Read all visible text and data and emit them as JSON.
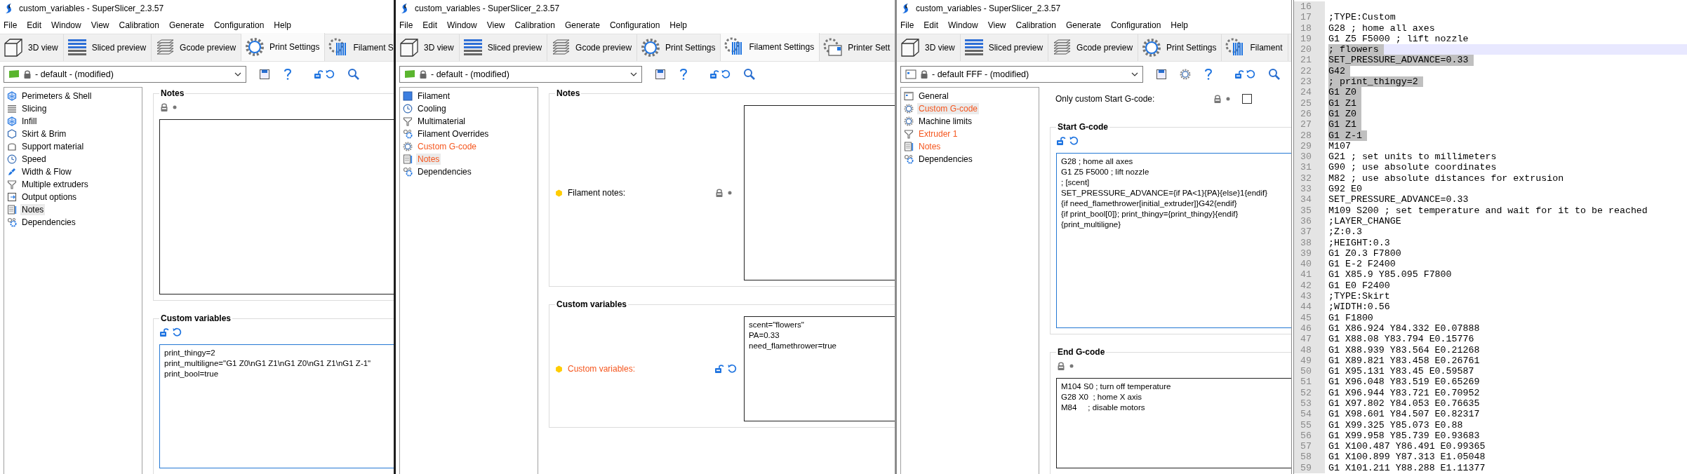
{
  "windows": [
    {
      "kind": "print",
      "title": "custom_variables - SuperSlicer_2.3.57",
      "menu": [
        "File",
        "Edit",
        "Window",
        "View",
        "Calibration",
        "Generate",
        "Configuration",
        "Help"
      ],
      "tabs": [
        {
          "label": "3D view",
          "kind": "view3d",
          "selected": false
        },
        {
          "label": "Sliced preview",
          "kind": "sliced",
          "selected": false
        },
        {
          "label": "Gcode preview",
          "kind": "gcode",
          "selected": false
        },
        {
          "label": "Print Settings",
          "kind": "print",
          "selected": true
        },
        {
          "label": "Filament S",
          "kind": "filament",
          "selected": false
        }
      ],
      "preset": "- default - (modified)",
      "sidebar": [
        {
          "label": "Perimeters & Shell",
          "kind": "perimeters",
          "selected": false,
          "modified": false
        },
        {
          "label": "Slicing",
          "kind": "slicing",
          "selected": false,
          "modified": false
        },
        {
          "label": "Infill",
          "kind": "infill",
          "selected": false,
          "modified": false
        },
        {
          "label": "Skirt & Brim",
          "kind": "skirt",
          "selected": false,
          "modified": false
        },
        {
          "label": "Support material",
          "kind": "support",
          "selected": false,
          "modified": false
        },
        {
          "label": "Speed",
          "kind": "speed",
          "selected": false,
          "modified": false
        },
        {
          "label": "Width & Flow",
          "kind": "width",
          "selected": false,
          "modified": false
        },
        {
          "label": "Multiple extruders",
          "kind": "extruders",
          "selected": false,
          "modified": false
        },
        {
          "label": "Output options",
          "kind": "output",
          "selected": false,
          "modified": false
        },
        {
          "label": "Notes",
          "kind": "notes",
          "selected": true,
          "modified": false
        },
        {
          "label": "Dependencies",
          "kind": "dependencies",
          "selected": false,
          "modified": false
        }
      ],
      "groups": [
        {
          "title": "Notes",
          "kind": "stacked",
          "locked": true,
          "focused": false
        },
        {
          "title": "Custom variables",
          "kind": "stacked",
          "locked": false,
          "focused": true,
          "lines": [
            "print_thingy=2",
            "print_multiligne=\"G1 Z0\\nG1 Z1\\nG1 Z0\\nG1 Z1\\nG1 Z-1\"",
            "print_bool=true"
          ]
        }
      ]
    },
    {
      "kind": "filament",
      "title": "custom_variables - SuperSlicer_2.3.57",
      "menu": [
        "File",
        "Edit",
        "Window",
        "View",
        "Calibration",
        "Generate",
        "Configuration",
        "Help"
      ],
      "tabs": [
        {
          "label": "3D view",
          "kind": "view3d",
          "selected": false
        },
        {
          "label": "Sliced preview",
          "kind": "sliced",
          "selected": false
        },
        {
          "label": "Gcode preview",
          "kind": "gcode",
          "selected": false
        },
        {
          "label": "Print Settings",
          "kind": "print",
          "selected": false
        },
        {
          "label": "Filament Settings",
          "kind": "filament",
          "selected": true
        },
        {
          "label": "Printer Sett",
          "kind": "printer",
          "selected": false
        }
      ],
      "preset": "- default - (modified)",
      "sidebar": [
        {
          "label": "Filament",
          "kind": "filament",
          "selected": false,
          "modified": false
        },
        {
          "label": "Cooling",
          "kind": "cooling",
          "selected": false,
          "modified": false
        },
        {
          "label": "Multimaterial",
          "kind": "multimaterial",
          "selected": false,
          "modified": false
        },
        {
          "label": "Filament Overrides",
          "kind": "overrides",
          "selected": false,
          "modified": false
        },
        {
          "label": "Custom G-code",
          "kind": "gcode",
          "selected": false,
          "modified": true
        },
        {
          "label": "Notes",
          "kind": "notes",
          "selected": true,
          "modified": true
        },
        {
          "label": "Dependencies",
          "kind": "dependencies",
          "selected": false,
          "modified": false
        }
      ],
      "groups": [
        {
          "title": "Notes",
          "kind": "side",
          "label": "Filament notes:",
          "modified": false,
          "locked": true,
          "focused": false
        },
        {
          "title": "Custom variables",
          "kind": "side",
          "label": "Custom variables:",
          "modified": true,
          "locked": false,
          "focused": false,
          "lines": [
            "scent=\"flowers\"",
            "PA=0.33",
            "need_flamethrower=true"
          ]
        }
      ]
    },
    {
      "kind": "printer",
      "title": "custom_variables - SuperSlicer_2.3.57",
      "menu": [
        "File",
        "Edit",
        "Window",
        "View",
        "Calibration",
        "Generate",
        "Configuration",
        "Help"
      ],
      "tabs": [
        {
          "label": "3D view",
          "kind": "view3d",
          "selected": false
        },
        {
          "label": "Sliced preview",
          "kind": "sliced",
          "selected": false
        },
        {
          "label": "Gcode preview",
          "kind": "gcode",
          "selected": false
        },
        {
          "label": "Print Settings",
          "kind": "print",
          "selected": false
        },
        {
          "label": "Filament",
          "kind": "filament",
          "selected": false
        }
      ],
      "preset": "- default FFF - (modified)",
      "sidebar": [
        {
          "label": "General",
          "kind": "general",
          "selected": false,
          "modified": false
        },
        {
          "label": "Custom G-code",
          "kind": "gcode",
          "selected": true,
          "modified": true
        },
        {
          "label": "Machine limits",
          "kind": "limits",
          "selected": false,
          "modified": false
        },
        {
          "label": "Extruder 1",
          "kind": "extruders",
          "selected": false,
          "modified": true
        },
        {
          "label": "Notes",
          "kind": "notes",
          "selected": false,
          "modified": true
        },
        {
          "label": "Dependencies",
          "kind": "dependencies",
          "selected": false,
          "modified": false
        }
      ],
      "option": {
        "label": "Only custom Start G-code:",
        "locked": true,
        "checked": false
      },
      "groups": [
        {
          "title": "Start G-code",
          "kind": "stacked",
          "locked": false,
          "focused": true,
          "lines": [
            "G28 ; home all axes",
            "G1 Z5 F5000 ; lift nozzle",
            "; [scent]",
            "SET_PRESSURE_ADVANCE={if PA<1}{PA}{else}1{endif}",
            "{if need_flamethrower[initial_extruder]}G42{endif}",
            "{if print_bool[0]}; print_thingy={print_thingy}{endif}",
            "{print_multiligne}"
          ]
        },
        {
          "title": "End G-code",
          "kind": "stacked",
          "locked": true,
          "focused": false,
          "lines": [
            "M104 S0 ; turn off temperature",
            "G28 X0  ; home X axis",
            "M84     ; disable motors"
          ]
        }
      ]
    }
  ],
  "editor": {
    "lines": [
      {
        "number": "16",
        "selected": false,
        "current": false
      },
      {
        "number": "17",
        "text": ";TYPE:Custom",
        "selected": false,
        "current": false
      },
      {
        "number": "18",
        "text": "G28 ; home all axes",
        "selected": false,
        "current": false
      },
      {
        "number": "19",
        "text": "G1 Z5 F5000 ; lift nozzle",
        "selected": false,
        "current": false
      },
      {
        "number": "20",
        "text": "; flowers",
        "selected": true,
        "current": true
      },
      {
        "number": "21",
        "text": "SET_PRESSURE_ADVANCE=0.33",
        "selected": true,
        "current": false
      },
      {
        "number": "22",
        "text": "G42",
        "selected": true,
        "current": false
      },
      {
        "number": "23",
        "text": "; print_thingy=2",
        "selected": true,
        "current": false
      },
      {
        "number": "24",
        "text": "G1 Z0",
        "selected": true,
        "current": false
      },
      {
        "number": "25",
        "text": "G1 Z1",
        "selected": true,
        "current": false
      },
      {
        "number": "26",
        "text": "G1 Z0",
        "selected": true,
        "current": false
      },
      {
        "number": "27",
        "text": "G1 Z1",
        "selected": true,
        "current": false
      },
      {
        "number": "28",
        "text": "G1 Z-1",
        "selected": true,
        "current": false
      },
      {
        "number": "29",
        "text": "M107",
        "selected": false,
        "current": false
      },
      {
        "number": "30",
        "text": "G21 ; set units to millimeters",
        "selected": false,
        "current": false
      },
      {
        "number": "31",
        "text": "G90 ; use absolute coordinates",
        "selected": false,
        "current": false
      },
      {
        "number": "32",
        "text": "M82 ; use absolute distances for extrusion",
        "selected": false,
        "current": false
      },
      {
        "number": "33",
        "text": "G92 E0",
        "selected": false,
        "current": false
      },
      {
        "number": "34",
        "text": "SET_PRESSURE_ADVANCE=0.33",
        "selected": false,
        "current": false
      },
      {
        "number": "35",
        "text": "M109 S200 ; set temperature and wait for it to be reached",
        "selected": false,
        "current": false
      },
      {
        "number": "36",
        "text": ";LAYER_CHANGE",
        "selected": false,
        "current": false
      },
      {
        "number": "37",
        "text": ";Z:0.3",
        "selected": false,
        "current": false
      },
      {
        "number": "38",
        "text": ";HEIGHT:0.3",
        "selected": false,
        "current": false
      },
      {
        "number": "39",
        "text": "G1 Z0.3 F7800",
        "selected": false,
        "current": false
      },
      {
        "number": "40",
        "text": "G1 E-2 F2400",
        "selected": false,
        "current": false
      },
      {
        "number": "41",
        "text": "G1 X85.9 Y85.095 F7800",
        "selected": false,
        "current": false
      },
      {
        "number": "42",
        "text": "G1 E0 F2400",
        "selected": false,
        "current": false
      },
      {
        "number": "43",
        "text": ";TYPE:Skirt",
        "selected": false,
        "current": false
      },
      {
        "number": "44",
        "text": ";WIDTH:0.56",
        "selected": false,
        "current": false
      },
      {
        "number": "45",
        "text": "G1 F1800",
        "selected": false,
        "current": false
      },
      {
        "number": "46",
        "text": "G1 X86.924 Y84.332 E0.07888",
        "selected": false,
        "current": false
      },
      {
        "number": "47",
        "text": "G1 X88.08 Y83.794 E0.15776",
        "selected": false,
        "current": false
      },
      {
        "number": "48",
        "text": "G1 X88.939 Y83.564 E0.21268",
        "selected": false,
        "current": false
      },
      {
        "number": "49",
        "text": "G1 X89.821 Y83.458 E0.26761",
        "selected": false,
        "current": false
      },
      {
        "number": "50",
        "text": "G1 X95.131 Y83.45 E0.59587",
        "selected": false,
        "current": false
      },
      {
        "number": "51",
        "text": "G1 X96.048 Y83.519 E0.65269",
        "selected": false,
        "current": false
      },
      {
        "number": "52",
        "text": "G1 X96.944 Y83.721 E0.70952",
        "selected": false,
        "current": false
      },
      {
        "number": "53",
        "text": "G1 X97.802 Y84.053 E0.76635",
        "selected": false,
        "current": false
      },
      {
        "number": "54",
        "text": "G1 X98.601 Y84.507 E0.82317",
        "selected": false,
        "current": false
      },
      {
        "number": "55",
        "text": "G1 X99.325 Y85.073 E0.88",
        "selected": false,
        "current": false
      },
      {
        "number": "56",
        "text": "G1 X99.958 Y85.739 E0.93683",
        "selected": false,
        "current": false
      },
      {
        "number": "57",
        "text": "G1 X100.487 Y86.491 E0.99365",
        "selected": false,
        "current": false
      },
      {
        "number": "58",
        "text": "G1 X100.899 Y87.313 E1.05048",
        "selected": false,
        "current": false
      },
      {
        "number": "59",
        "text": "G1 X101.211 Y88.288 E1.11377",
        "selected": false,
        "current": false
      }
    ]
  }
}
